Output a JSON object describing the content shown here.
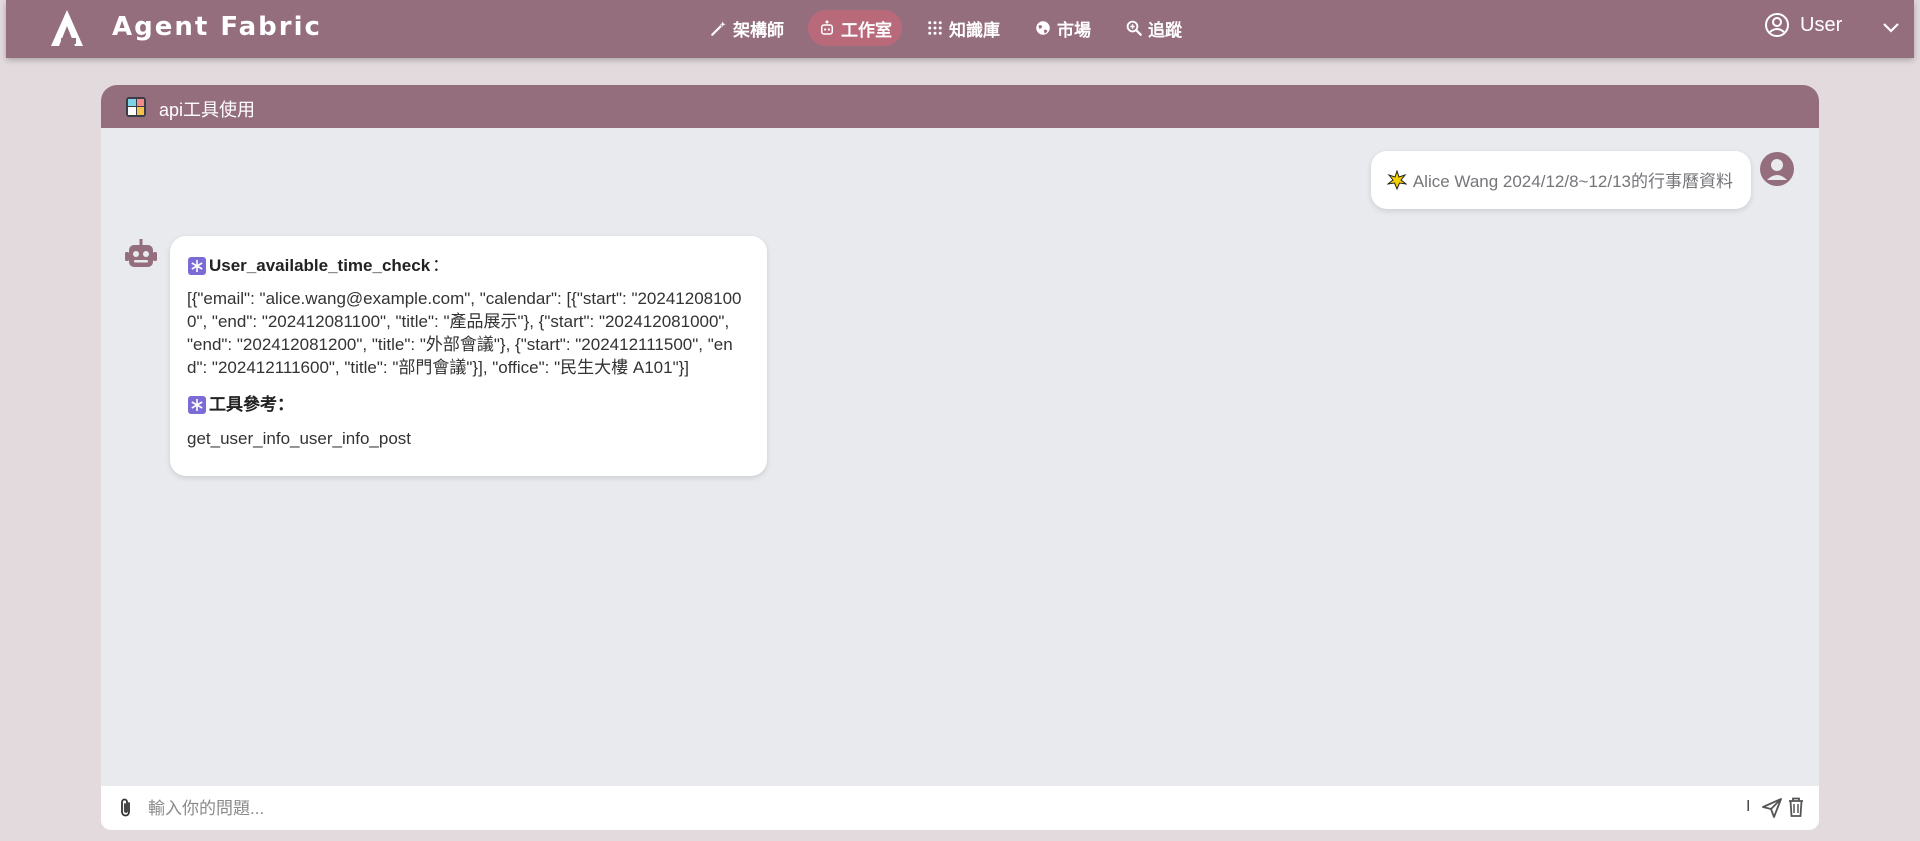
{
  "app": {
    "title": "Agent Fabric"
  },
  "nav": {
    "items": [
      {
        "label": "架構師",
        "icon": "magic-wand-icon",
        "active": false
      },
      {
        "label": "工作室",
        "icon": "robot-head-icon",
        "active": true
      },
      {
        "label": "知識庫",
        "icon": "apps-grid-icon",
        "active": false
      },
      {
        "label": "市場",
        "icon": "globe-icon",
        "active": false
      },
      {
        "label": "追蹤",
        "icon": "search-zoom-icon",
        "active": false
      }
    ]
  },
  "user": {
    "name": "User"
  },
  "chat": {
    "title": "api工具使用",
    "messages": {
      "user": {
        "text": "Alice Wang 2024/12/8~12/13的行事曆資料",
        "icon": "sparkle-icon"
      },
      "bot": {
        "heading1": "User_available_time_check",
        "heading1_suffix": "：",
        "json_text": "[{\"email\": \"alice.wang@example.com\", \"calendar\": [{\"start\": \"202412081000\", \"end\": \"202412081100\", \"title\": \"產品展示\"}, {\"start\": \"202412081000\", \"end\": \"202412081200\", \"title\": \"外部會議\"}, {\"start\": \"202412111500\", \"end\": \"202412111600\", \"title\": \"部門會議\"}], \"office\": \"民生大樓 A101\"}]",
        "heading2": "工具參考：",
        "tool_name": "get_user_info_user_info_post"
      }
    },
    "input": {
      "placeholder": "輸入你的問題...",
      "value": "",
      "counter": "I"
    }
  },
  "colors": {
    "nav_bg": "#956e7e",
    "nav_active": "#b86a7b",
    "page_bg": "#e3dadd",
    "chat_bg": "#e8eaee"
  }
}
